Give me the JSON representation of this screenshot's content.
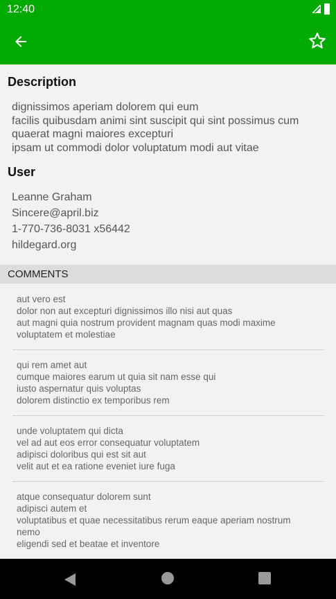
{
  "status_bar": {
    "time": "12:40"
  },
  "toolbar": {
    "back_icon": "arrow-back-icon",
    "favorite_icon": "star-outline-icon"
  },
  "description": {
    "heading": "Description",
    "lines": [
      "dignissimos aperiam dolorem qui eum",
      "facilis quibusdam animi sint suscipit qui sint possimus cum",
      "quaerat magni maiores excepturi",
      "ipsam ut commodi dolor voluptatum modi aut vitae"
    ]
  },
  "user": {
    "heading": "User",
    "name": "Leanne Graham",
    "email": "Sincere@april.biz",
    "phone": "1-770-736-8031 x56442",
    "website": "hildegard.org"
  },
  "comments": {
    "header": "COMMENTS",
    "items": [
      {
        "lines": [
          "aut vero est",
          "dolor non aut excepturi dignissimos illo nisi aut quas",
          "aut magni quia nostrum provident magnam quas modi maxime",
          "voluptatem et molestiae"
        ]
      },
      {
        "lines": [
          "qui rem amet aut",
          "cumque maiores earum ut quia sit nam esse qui",
          "iusto aspernatur quis voluptas",
          "dolorem distinctio ex temporibus rem"
        ]
      },
      {
        "lines": [
          "unde voluptatem qui dicta",
          "vel ad aut eos error consequatur voluptatem",
          "adipisci doloribus qui est sit aut",
          "velit aut et ea ratione eveniet iure fuga"
        ]
      },
      {
        "lines": [
          "atque consequatur dolorem sunt",
          "adipisci autem et",
          "voluptatibus et quae necessitatibus rerum eaque aperiam nostrum",
          "nemo",
          "eligendi sed et beatae et inventore"
        ]
      }
    ]
  },
  "colors": {
    "primary": "#00aa00",
    "background": "#f2f2f2",
    "divider": "#cfcfcf"
  }
}
